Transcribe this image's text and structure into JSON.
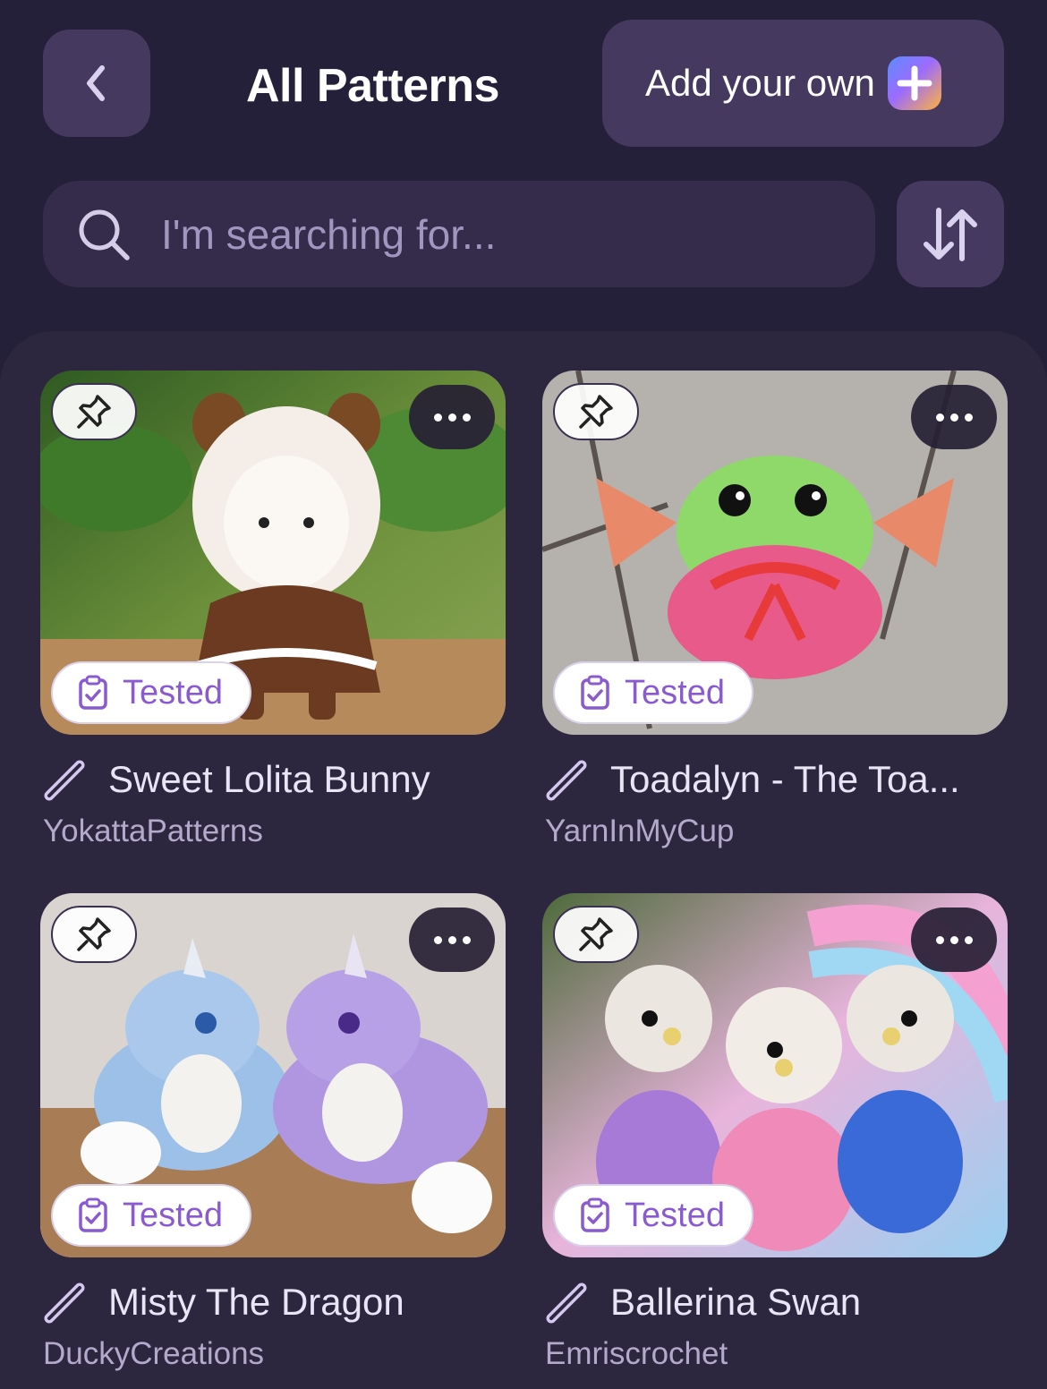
{
  "header": {
    "back_icon": "chevron-left-icon",
    "title": "All Patterns",
    "add_button_label": "Add your own",
    "add_icon": "plus-gradient-icon"
  },
  "search": {
    "placeholder": "I'm searching for...",
    "search_icon": "search-icon",
    "sort_icon": "sort-arrows-icon"
  },
  "colors": {
    "background": "#25203a",
    "panel": "#2d263f",
    "button": "#45395f",
    "badge_text": "#8a5ad0"
  },
  "patterns": [
    {
      "title": "Sweet Lolita Bunny",
      "author": "YokattaPatterns",
      "badge": "Tested"
    },
    {
      "title": "Toadalyn - The Toa...",
      "author": "YarnInMyCup",
      "badge": "Tested"
    },
    {
      "title": "Misty The Dragon",
      "author": "DuckyCreations",
      "badge": "Tested"
    },
    {
      "title": "Ballerina Swan",
      "author": "Emriscrochet",
      "badge": "Tested"
    }
  ]
}
